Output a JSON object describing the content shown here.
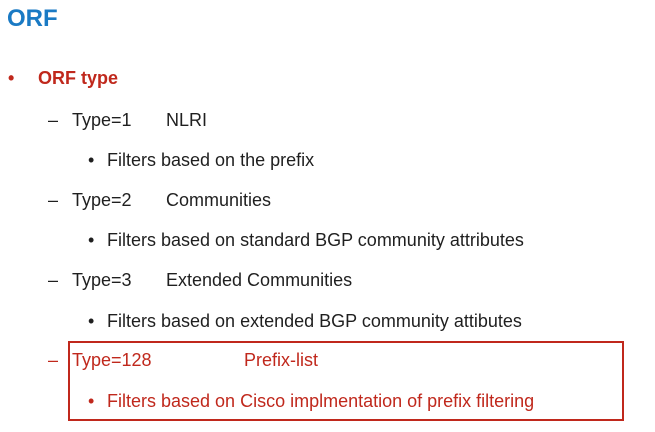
{
  "title": "ORF",
  "level1": {
    "bullet": "•",
    "text": "ORF type"
  },
  "types": [
    {
      "dash": "–",
      "code": "Type=1",
      "name": "NLRI",
      "bullet": "•",
      "description": "Filters based on the prefix"
    },
    {
      "dash": "–",
      "code": "Type=2",
      "name": "Communities",
      "bullet": "•",
      "description": "Filters based on standard BGP community attributes"
    },
    {
      "dash": "–",
      "code": "Type=3",
      "name": "Extended Communities",
      "bullet": "•",
      "description": "Filters based on extended BGP community attibutes"
    },
    {
      "dash": "–",
      "code": "Type=128",
      "name": "Prefix-list",
      "bullet": "•",
      "description": "Filters based on Cisco implmentation of prefix filtering"
    }
  ],
  "colors": {
    "title": "#1a7ac4",
    "highlight": "#c0281c",
    "text": "#1f1f1f"
  }
}
